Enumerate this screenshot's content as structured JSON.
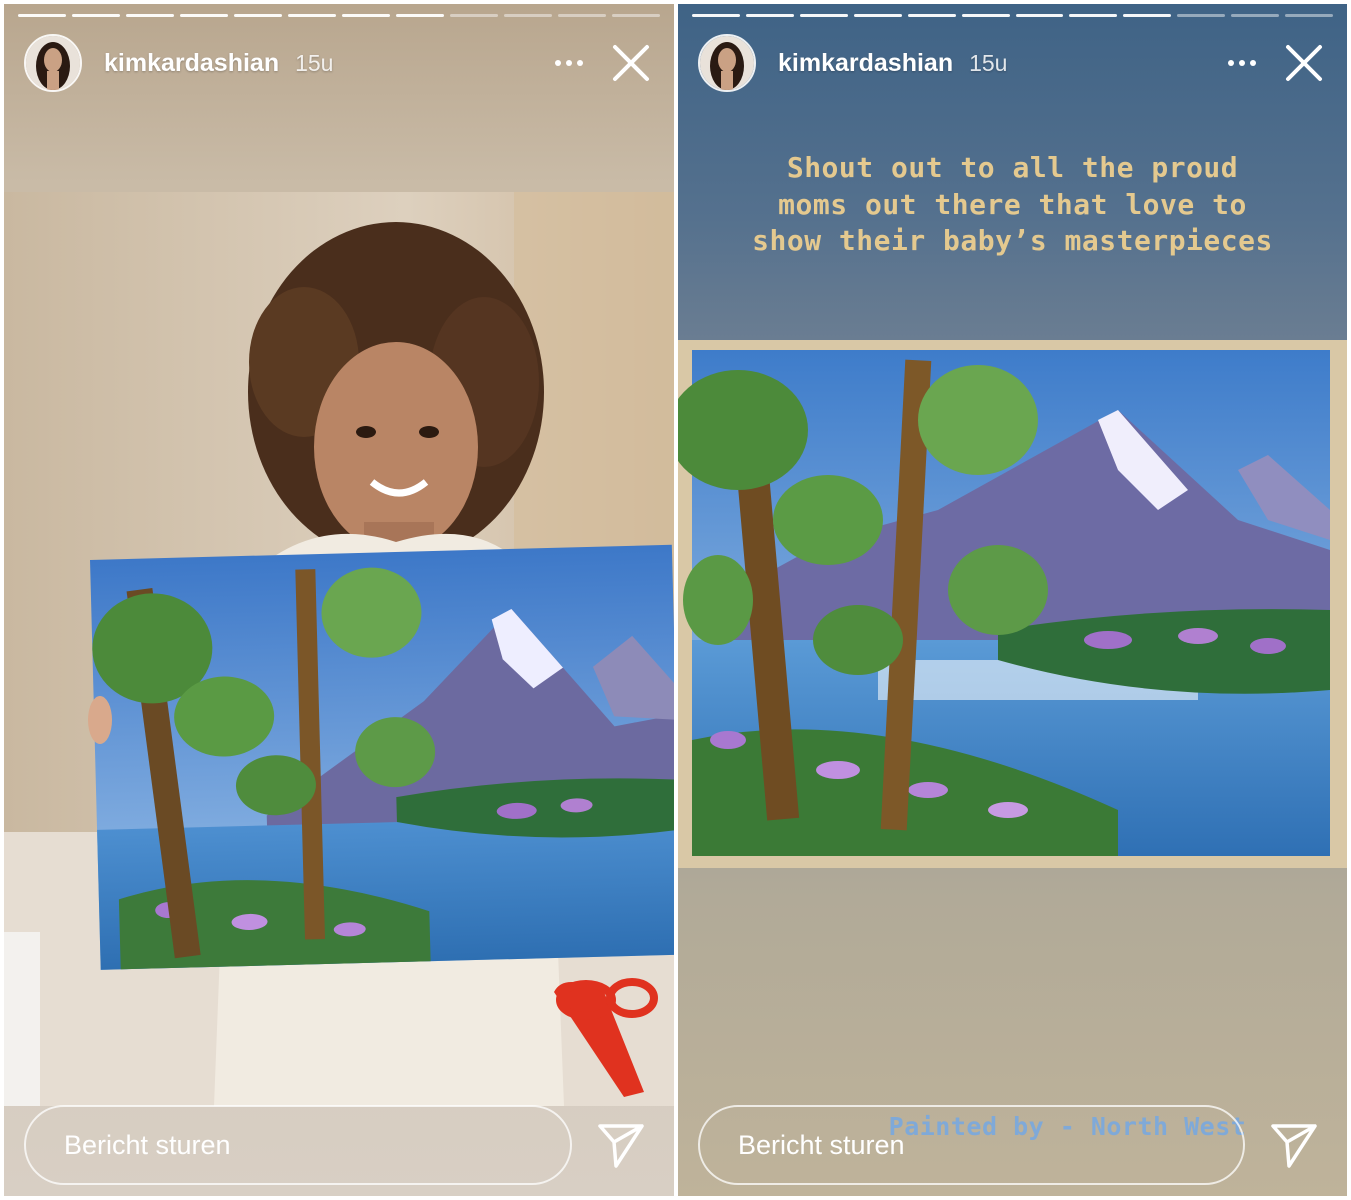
{
  "stories": [
    {
      "username": "kimkardashian",
      "time": "15u",
      "progress_total": 12,
      "progress_done": 8,
      "reply_placeholder": "Bericht sturen"
    },
    {
      "username": "kimkardashian",
      "time": "15u",
      "progress_total": 12,
      "progress_done": 9,
      "caption": "Shout out to all the proud\nmoms out there that love to\nshow their baby’s masterpieces",
      "credit": "Painted by - North West",
      "reply_placeholder": "Bericht sturen"
    }
  ],
  "icons": {
    "more": "more-horizontal-icon",
    "close": "close-icon",
    "send": "paper-plane-icon"
  },
  "colors": {
    "caption": "#e4c98f",
    "credit": "#7fa9d8",
    "text": "#ffffff"
  }
}
